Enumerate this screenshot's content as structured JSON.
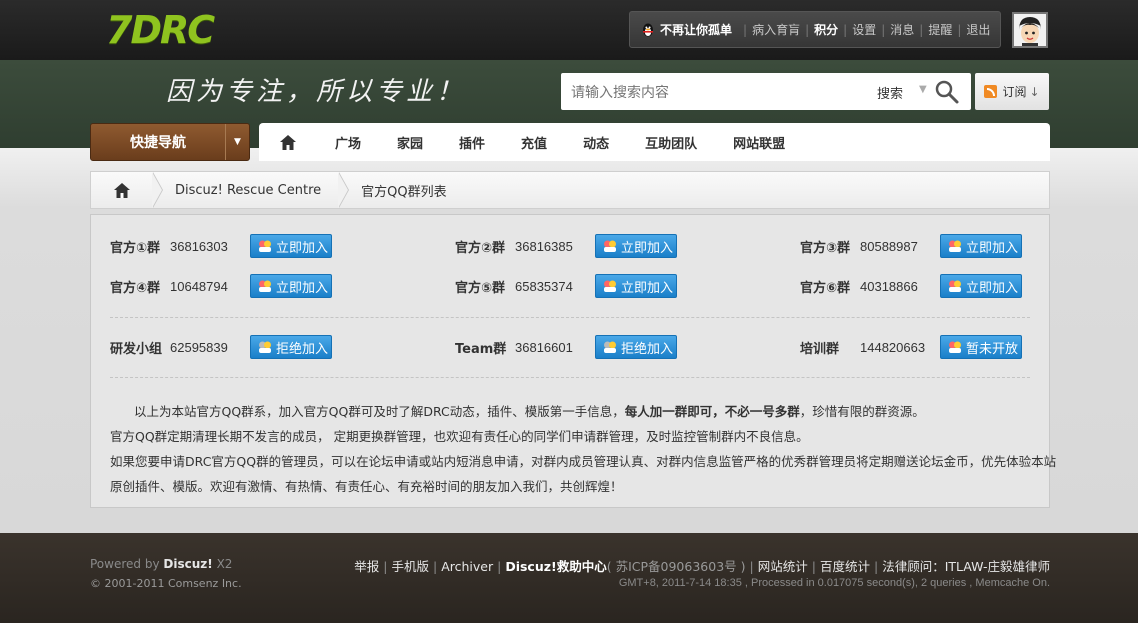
{
  "header": {
    "logo_text": "7DRC",
    "user": {
      "name": "不再让你孤单",
      "links": [
        "病入育肓"
      ],
      "score_label": "积分",
      "menu": [
        "设置",
        "消息",
        "提醒",
        "退出"
      ]
    },
    "slogan": "因为专注，所以专业！",
    "search": {
      "placeholder": "请输入搜索内容",
      "type": "搜索"
    },
    "subscribe_label": "订阅"
  },
  "nav": {
    "quick_nav_label": "快捷导航",
    "tabs": [
      "广场",
      "家园",
      "插件",
      "充值",
      "动态",
      "互助团队",
      "网站联盟"
    ]
  },
  "breadcrumb": {
    "items": [
      "Discuz! Rescue Centre",
      "官方QQ群列表"
    ]
  },
  "groups": {
    "row1": [
      {
        "name": "官方①群",
        "number": "36816303",
        "action": "立即加入"
      },
      {
        "name": "官方②群",
        "number": "36816385",
        "action": "立即加入"
      },
      {
        "name": "官方③群",
        "number": "80588987",
        "action": "立即加入"
      }
    ],
    "row2": [
      {
        "name": "官方④群",
        "number": "10648794",
        "action": "立即加入"
      },
      {
        "name": "官方⑤群",
        "number": "65835374",
        "action": "立即加入"
      },
      {
        "name": "官方⑥群",
        "number": "40318866",
        "action": "立即加入"
      }
    ],
    "row3": [
      {
        "name": "研发小组",
        "number": "62595839",
        "action": "拒绝加入"
      },
      {
        "name": "Team群",
        "number": "36816601",
        "action": "拒绝加入"
      },
      {
        "name": "培训群",
        "number": "144820663",
        "action": "暂未开放"
      }
    ]
  },
  "notice": {
    "line1_a": "以上为本站官方QQ群系，加入官方QQ群可及时了解DRC动态，插件、模版第一手信息，",
    "line1_bold": "每人加一群即可，不必一号多群",
    "line1_b": "，珍惜有限的群资源。",
    "line2": "官方QQ群定期清理长期不发言的成员， 定期更换群管理，也欢迎有责任心的同学们申请群管理，及时监控管制群内不良信息。",
    "line3": "如果您要申请DRC官方QQ群的管理员，可以在论坛申请或站内短消息申请，对群内成员管理认真、对群内信息监管严格的优秀群管理员将定期赠送论坛金币，优先体验本站",
    "line4": "原创插件、模版。欢迎有激情、有热情、有责任心、有充裕时间的朋友加入我们，共创辉煌！"
  },
  "footer": {
    "powered_prefix": "Powered by",
    "powered_brand": "Discuz!",
    "powered_version": "X2",
    "copyright": "© 2001-2011 Comsenz Inc.",
    "links": [
      "举报",
      "手机版",
      "Archiver"
    ],
    "rescue_center": "Discuz!救助中心",
    "icp": "( 苏ICP备09063603号 )",
    "links2": [
      "网站统计",
      "百度统计",
      "法律顾问：ITLAW-庄毅雄律师"
    ],
    "info": "GMT+8, 2011-7-14 18:35 , Processed in 0.017075 second(s), 2 queries , Memcache On."
  },
  "colors": {
    "logo_green": "#8fc31f",
    "quick_nav_brown": "#7a4a24",
    "join_button_blue": "#2a8fd8"
  }
}
